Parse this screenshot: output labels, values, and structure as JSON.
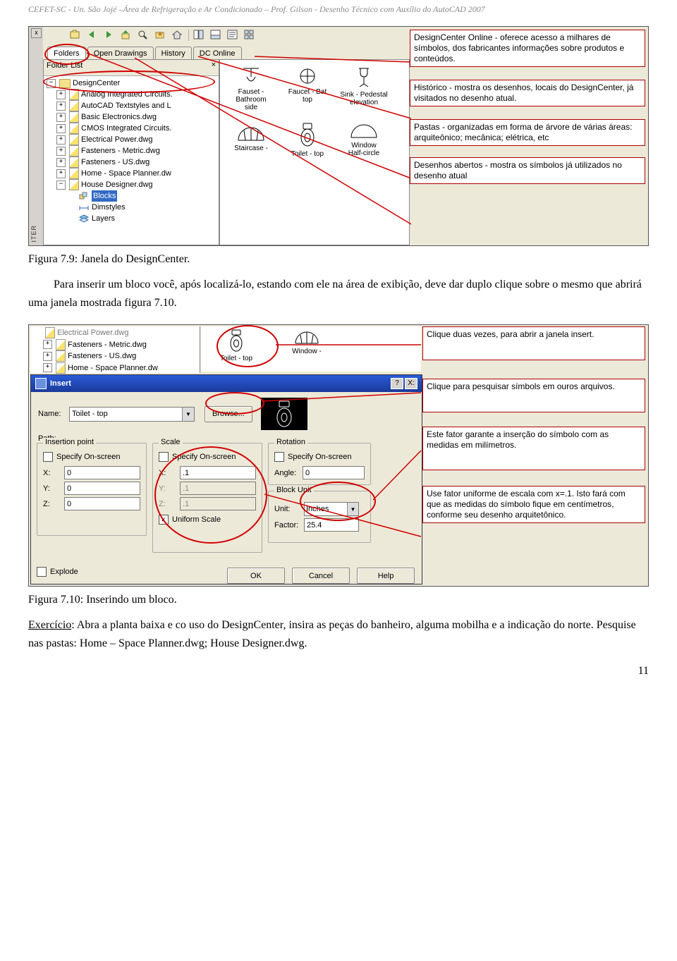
{
  "header": "CEFET-SC -  Un. São Jojé –Área de Refrigeração e Ar Condicionado – Prof. Gilson - Desenho Técnico com Auxílio do AutoCAD 2007",
  "page_number": "11",
  "caption1": "Figura 7.9: Janela do DesignCenter.",
  "paragraph1": "Para inserir um bloco você, após localizá-lo, estando com ele na área de exibição, deve dar duplo clique sobre o mesmo que abrirá uma janela mostrada figura 7.10.",
  "caption2": "Figura 7.10: Inserindo um bloco.",
  "exercise_label": "Exercício",
  "exercise_text": ": Abra a planta baixa e co uso do DesignCenter, insira as peças do banheiro, alguma mobilha e a indicação do norte. Pesquise nas pastas: Home – Space Planner.dwg; House Designer.dwg.",
  "ss1": {
    "close_x": "x",
    "iter": "ITER",
    "tabs": {
      "folders": "Folders",
      "open": "Open Drawings",
      "history": "History",
      "dc": "DC Online"
    },
    "folder_list": "Folder List",
    "folder_x": "×",
    "tree": {
      "root": "DesignCenter",
      "items": [
        "Analog Integrated Circuits.",
        "AutoCAD Textstyles and L",
        "Basic Electronics.dwg",
        "CMOS Integrated Circuits.",
        "Electrical Power.dwg",
        "Fasteners - Metric.dwg",
        "Fasteners - US.dwg",
        "Home - Space Planner.dw",
        "House Designer.dwg"
      ],
      "sub": {
        "blocks": "Blocks",
        "dimstyles": "Dimstyles",
        "layers": "Layers"
      }
    },
    "thumbs": {
      "t1a": "Fauset - Bathroom",
      "t1a2": "side",
      "t1b": "Faucet - Bat",
      "t1b2": "top",
      "t2a": "Sink - Pedestal",
      "t2a2": "elevation",
      "t2b": "Staircase -",
      "t3a": "Toilet - top",
      "t3b": "Window",
      "t3b2": "Half-circle"
    }
  },
  "anno1": {
    "a": "DesignCenter Online - oferece acesso a milhares de símbolos, dos fabricantes informações sobre produtos e conteúdos.",
    "b": "Histórico - mostra os desenhos, locais do DesignCenter, já visitados no desenho atual.",
    "c": "Pastas - organizadas em forma de árvore de várias áreas: arquiteônico; mecânica; elétrica, etc",
    "d": "Desenhos abertos - mostra os símbolos já utilizados no desenho atual"
  },
  "ss2": {
    "tree_top": "Electrical Power.dwg",
    "tree": [
      "Fasteners - Metric.dwg",
      "Fasteners - US.dwg",
      "Home - Space Planner.dw"
    ],
    "thumb1": "Toilet - top",
    "thumb2a": "Window -",
    "insert": {
      "title": "Insert",
      "q": "?",
      "x": "X:",
      "name_lbl": "Name:",
      "name_val": "Toilet - top",
      "browse": "Browse...",
      "path_lbl": "Path:",
      "g_insertion": "Insertion point",
      "g_scale": "Scale",
      "g_rotation": "Rotation",
      "g_block": "Block Unit",
      "specify": "Specify On-screen",
      "y": "Y:",
      "z": "Z:",
      "x0": "0",
      "y0": "0",
      "z0": "0",
      "sx": ".1",
      "sy": ".1",
      "sz": ".1",
      "angle_lbl": "Angle:",
      "angle_val": "0",
      "unit_lbl": "Unit:",
      "unit_val": "Inches",
      "factor_lbl": "Factor:",
      "factor_val": "25.4",
      "uniform": "Uniform Scale",
      "explode": "Explode",
      "ok": "OK",
      "cancel": "Cancel",
      "help": "Help"
    }
  },
  "anno2": {
    "a": "Clique duas vezes, para abrir a janela insert.",
    "b": "Clique para pesquisar símbols em ouros arquivos.",
    "c": "Este fator garante a inserção do símbolo com as medidas em milímetros.",
    "d": "Use fator uniforme de escala com x=.1. Isto fará com que as medidas do símbolo fique em centímetros, conforme seu desenho arquitetônico."
  }
}
